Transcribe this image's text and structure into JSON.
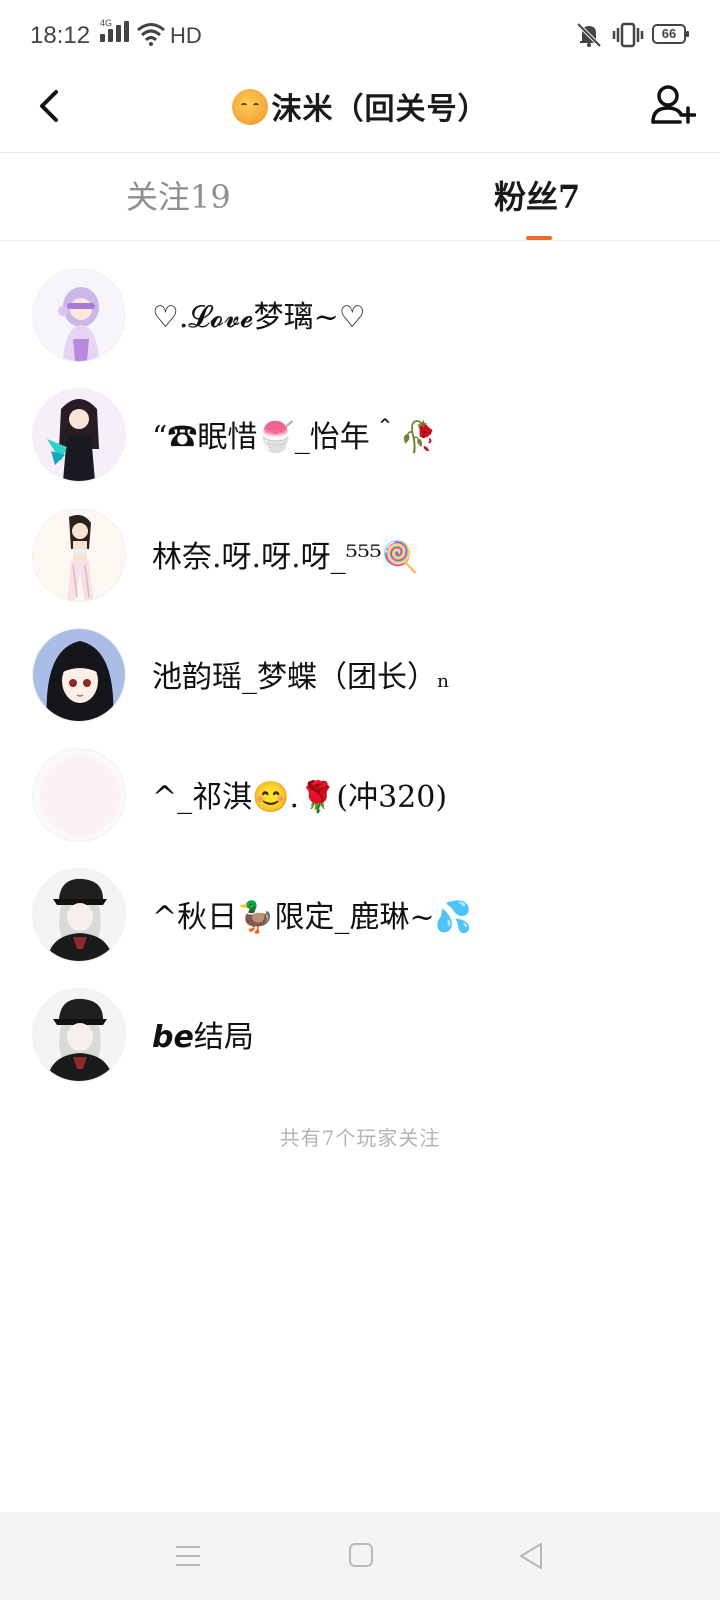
{
  "status_bar": {
    "time": "18:12",
    "network": "4G",
    "hd": "HD",
    "battery": "66",
    "icons": [
      "signal-icon",
      "wifi-icon",
      "mute-icon",
      "vibrate-icon",
      "battery-icon"
    ]
  },
  "header": {
    "title": "沫米（回关号）",
    "title_emoji": "face-emoji-icon",
    "back_icon": "back-arrow-icon",
    "add_icon": "add-user-icon"
  },
  "tabs": [
    {
      "label": "关注19",
      "active": false
    },
    {
      "label": "粉丝7",
      "active": true
    }
  ],
  "accent_color": "#f06a2a",
  "fans": [
    {
      "name": "♡.𝓛𝓸𝓿𝓮梦璃~♡",
      "avatar": "anime-girl-purple"
    },
    {
      "name": "“☎眠惜🍧_怡年＾🥀",
      "avatar": "anime-girl-dark"
    },
    {
      "name": "林奈.呀.呀.呀_⁵⁵⁵🍭",
      "avatar": "anime-girl-bikini"
    },
    {
      "name": "池韵瑶_梦蝶（团长）ₙ",
      "avatar": "anime-girl-blackhair"
    },
    {
      "name": "^_祁淇😊.🌹(冲320)",
      "avatar": "blank-white"
    },
    {
      "name": "^秋日🦆限定_鹿琳~💦",
      "avatar": "anime-boy-cap"
    },
    {
      "name": "𝙗𝙚结局",
      "avatar": "anime-boy-cap"
    }
  ],
  "footer_note": "共有7个玩家关注",
  "nav": [
    "menu-icon",
    "home-icon",
    "back-triangle-icon"
  ]
}
